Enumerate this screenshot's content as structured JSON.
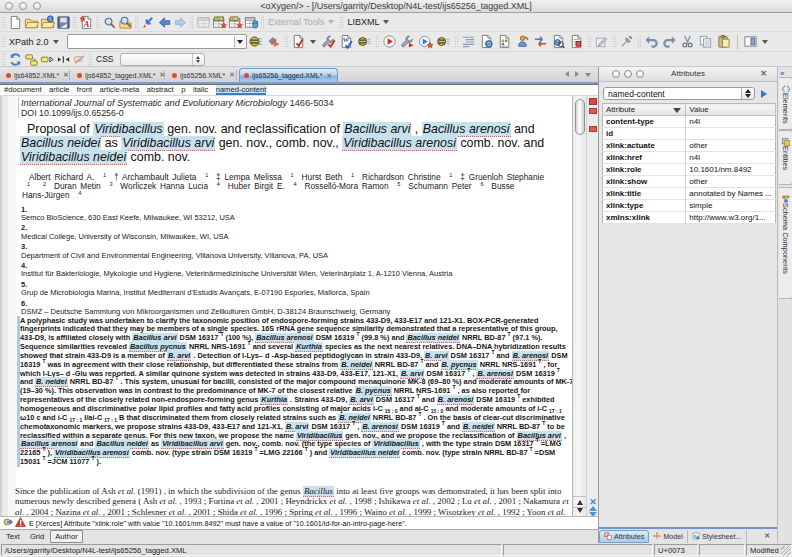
{
  "window": {
    "title": "<oXygen/> - [/Users/garrity/Desktop/N4L-test/ijs65256_tagged.XML]"
  },
  "toolbar": {
    "row1": [
      {
        "sep": 1
      },
      {
        "icon": "new-document"
      },
      {
        "icon": "open-folder"
      },
      {
        "icon": "open-url"
      },
      {
        "icon": "save"
      },
      {
        "sep": 1
      },
      {
        "icon": "new-from-template"
      },
      {
        "sep": 1
      },
      {
        "icon": "search"
      },
      {
        "icon": "search-in-files"
      },
      {
        "sep": 1
      },
      {
        "icon": "go-to-last-edit"
      },
      {
        "icon": "back"
      },
      {
        "icon": "forward"
      },
      {
        "sep": 1
      },
      {
        "icon": "grid-view"
      },
      {
        "icon": "xslt-transform"
      },
      {
        "icon": "xquery-transform"
      },
      {
        "icon": "database-table"
      },
      {
        "sep": 1
      },
      {
        "label": "External Tools",
        "caret": 1,
        "gray": 1
      },
      {
        "sep": 1
      },
      {
        "label": "LIBXML",
        "caret": 1
      }
    ],
    "row2a_label": "XPath 2.0",
    "row2": [
      {
        "icon": "watch-settings"
      },
      {
        "icon": "switch-arrows"
      },
      {
        "sep": 1
      },
      {
        "icon": "validate"
      },
      {
        "caret": 1
      },
      {
        "icon": "validate-schema"
      },
      {
        "icon": "well-formed"
      },
      {
        "icon": "key"
      },
      {
        "sep": 1
      },
      {
        "icon": "apply-transformation"
      },
      {
        "icon": "configure-transformation"
      },
      {
        "icon": "debug-transformation"
      },
      {
        "icon": "key"
      },
      {
        "sep": 1
      },
      {
        "icon": "format-indent"
      },
      {
        "icon": "doc-globe"
      },
      {
        "icon": "doc-colors"
      },
      {
        "icon": "person-pin"
      },
      {
        "icon": "compare-arrows"
      },
      {
        "icon": "doc-search"
      },
      {
        "icon": "doc-red-box"
      },
      {
        "sep": 1
      },
      {
        "icon": "edit-pencil"
      },
      {
        "sep": 1
      },
      {
        "icon": "pin-brush"
      },
      {
        "sep": 1
      },
      {
        "icon": "undo"
      },
      {
        "icon": "redo"
      },
      {
        "icon": "cut"
      },
      {
        "icon": "copy"
      },
      {
        "icon": "paste"
      },
      {
        "vline": 1
      },
      {
        "icon": "panel-layout"
      },
      {
        "caret": 1
      }
    ],
    "row3": [
      {
        "sep": 1
      },
      {
        "icon": "refresh-sync"
      },
      {
        "icon": "tags"
      },
      {
        "icon": "tag-arrow"
      },
      {
        "icon": "collapse-tags"
      },
      {
        "icon": "tag-disabled"
      },
      {
        "sep": 1
      },
      {
        "label": "CSS"
      }
    ],
    "css_label": "CSS"
  },
  "tabs": [
    {
      "label": "ijs64852.XML*"
    },
    {
      "label": "ijs64852_tagged.XML*"
    },
    {
      "label": "ijs65256.XML*"
    },
    {
      "label": "ijs65256_tagged.XML*",
      "selected": true
    }
  ],
  "breadcrumb": [
    "#document",
    "article",
    "front",
    "article-meta",
    "abstract",
    "p",
    "italic",
    "named-content"
  ],
  "document": {
    "journal": "International Journal of Systematic and Evolutionary Microbiology",
    "issn": "1466-5034",
    "doi": "DOI 10.1099/ijs.0.65256-0",
    "title_lines": [
      [
        "Proposal of ",
        {
          "t": "Viridibacillus",
          "c": "hl"
        },
        " gen. nov. and reclassification of ",
        {
          "t": "Bacillus arvi",
          "c": "hl"
        },
        " , ",
        {
          "t": "Bacillus arenosi",
          "c": "hl"
        },
        " and"
      ],
      [
        {
          "t": "Bacillus neidei",
          "c": "hl"
        },
        " as ",
        {
          "t": "Viridibacillus arvi",
          "c": "hl"
        },
        " gen. nov., comb. nov., ",
        {
          "t": "Viridibacillus arenosi",
          "c": "hl"
        },
        " comb. nov. and"
      ],
      [
        {
          "t": "Viridibacillus neidei",
          "c": "hl"
        },
        " comb. nov."
      ]
    ],
    "author_lines": [
      [
        "Albert Richard A. ",
        {
          "t": "1",
          "c": "sup"
        },
        " †   Archambault Julieta ",
        {
          "t": "1",
          "c": "sup"
        },
        " ‡   Lempa Melissa ",
        {
          "t": "1",
          "c": "sup"
        },
        "   Hurst Beth ",
        {
          "t": "1",
          "c": "sup"
        },
        "   Richardson Christine ",
        {
          "t": "1",
          "c": "sup"
        },
        " ‡   Gruenloh Stephanie"
      ],
      [
        {
          "t": "1",
          "c": "sup"
        },
        " ",
        {
          "t": "2",
          "c": "sup"
        },
        "   Duran Metin ",
        {
          "t": "3",
          "c": "sup"
        },
        "   Worliczek Hanna Lucia ",
        {
          "t": "4",
          "c": "sup"
        },
        "   Huber Birgit E. ",
        {
          "t": "4",
          "c": "sup"
        },
        "   Rosselló-Mora Ramon ",
        {
          "t": "5",
          "c": "sup"
        },
        "   Schumann Peter ",
        {
          "t": "6",
          "c": "sup"
        },
        "   Busse"
      ],
      [
        "Hans-Jürgen ",
        {
          "t": "4",
          "c": "sup"
        }
      ]
    ],
    "affiliations": [
      {
        "n": "1.",
        "text": "Semco BioScience, 630 East Keefe, Milwaukee, WI 53212, USA"
      },
      {
        "n": "2.",
        "text": "Medical College, University of Wisconsin, Milwaukee, WI, USA"
      },
      {
        "n": "3.",
        "text": "Department of Civil and Environmental Engineering, Villanova University, Villanova, PA, USA"
      },
      {
        "n": "4.",
        "text": "Institut für Bakteriologie, Mykologie und Hygiene, Veterinärmedizinische Universität Wien, Veterinärplatz 1, A-1210 Vienna, Austria"
      },
      {
        "n": "5.",
        "text": "Grup de Microbiologia Marina, Institut Mediterrani d'Estudis Avançats, E-07190 Esporles, Mallorca, Spain"
      },
      {
        "n": "6.",
        "text": "DSMZ – Deutsche Sammlung von Mikroorganismen und Zellkulturen GmbH, D-38124 Braunschweig, Germany"
      }
    ],
    "abstract_lines": [
      [
        "A polyphasic study was undertaken to clarify the taxonomic position of endospore-forming strains 433-D9, 433-E17 and 121-X1. BOX-PCR-generated"
      ],
      [
        "fingerprints indicated that they may be members of a single species. 16S rRNA gene sequence similarity demonstrated that a representative of this group,"
      ],
      [
        "433-D9, is affiliated closely with ",
        {
          "t": "Bacillus arvi",
          "c": "hl"
        },
        " DSM 16317 ",
        {
          "t": "T",
          "c": "sup"
        },
        " (100 %), ",
        {
          "t": "Bacillus arenosi",
          "c": "hl"
        },
        " DSM 16319 ",
        {
          "t": "T",
          "c": "sup"
        },
        " (99.8 %) and ",
        {
          "t": "Bacillus neidei",
          "c": "hl"
        },
        " NRRL BD-87 ",
        {
          "t": "T",
          "c": "sup"
        },
        " (97.1 %)."
      ],
      [
        "Sequence similarities revealed ",
        {
          "t": "Bacillus pycnus",
          "c": "hl"
        },
        " NRRL NRS-1691 ",
        {
          "t": "T",
          "c": "sup"
        },
        " and several ",
        {
          "t": "Kurthia",
          "c": "hl"
        },
        " species as the next nearest relatives. DNA–DNA hybridization results"
      ],
      [
        "showed that strain 433-D9 is a member of ",
        {
          "t": "B. arvi",
          "c": "hl"
        },
        " . Detection of l-Lys– d -Asp-based peptidoglycan in strain 433-D9, ",
        {
          "t": "B. arvi",
          "c": "hl"
        },
        " DSM 16317 ",
        {
          "t": "T",
          "c": "sup"
        },
        " and ",
        {
          "t": "B. arenosi",
          "c": "hl"
        },
        " DSM"
      ],
      [
        "16319 ",
        {
          "t": "T",
          "c": "sup"
        },
        " was in agreement with their close relationship, but differentiated these strains from ",
        {
          "t": "B. neidei",
          "c": "hl"
        },
        " NRRL BD-87 ",
        {
          "t": "T",
          "c": "sup"
        },
        " and ",
        {
          "t": "B. pycnus",
          "c": "hl"
        },
        " NRRL NRS-1691 ",
        {
          "t": "T",
          "c": "sup"
        },
        " , for"
      ],
      [
        "which l-Lys– d -Glu was reported. A similar quinone system was detected in strains 433-D9, 433-E17, 121-X1, ",
        {
          "t": "B. arvi",
          "c": "hl"
        },
        " DSM 16317 ",
        {
          "t": "T",
          "c": "sup"
        },
        " , ",
        {
          "t": "B. arenosi",
          "c": "hl"
        },
        " DSM 16319 ",
        {
          "t": "T",
          "c": "sup"
        }
      ],
      [
        "and ",
        {
          "t": "B. neidei",
          "c": "hl"
        },
        " NRRL BD-87 ",
        {
          "t": "T",
          "c": "sup"
        },
        " . This system, unusual for bacilli, consisted of the major compound menaquinone MK-8 (69–80 %) and moderate amounts of MK-7"
      ],
      [
        "(19–30 %). This observation was in contrast to the predominance of MK-7 of the closest relative ",
        {
          "t": "B. pycnus",
          "c": "hl"
        },
        " NRRL NRS-1691 ",
        {
          "t": "T",
          "c": "sup"
        },
        " , as also reported for"
      ],
      [
        "representatives of the closely related non-endospore-forming genus ",
        {
          "t": "Kurthia",
          "c": "hl"
        },
        " . Strains 433-D9, ",
        {
          "t": "B. arvi",
          "c": "hl"
        },
        " DSM 16317 ",
        {
          "t": "T",
          "c": "sup"
        },
        " and ",
        {
          "t": "B. arenosi",
          "c": "hl"
        },
        " DSM 16319 ",
        {
          "t": "T",
          "c": "sup"
        },
        " exhibited"
      ],
      [
        "homogeneous and discriminative polar lipid profiles and fatty acid profiles consisting of major acids i-C ",
        {
          "t": "15 : 0",
          "c": "sub"
        },
        " and ai-C ",
        {
          "t": "15 : 0",
          "c": "sub"
        },
        " and moderate amounts of i-C ",
        {
          "t": "17 : 1",
          "c": "sub"
        }
      ],
      [
        "ω10 c and i-C ",
        {
          "t": "17 : 1",
          "c": "sub"
        },
        " I/ai-C ",
        {
          "t": "17 : 1",
          "c": "sub"
        },
        " B that discriminated them from closely related strains such as ",
        {
          "t": "B. neidei",
          "c": "hl"
        },
        " NRRL BD-87 ",
        {
          "t": "T",
          "c": "sup"
        },
        " . On the basis of clear-cut discriminative"
      ],
      [
        "chemotaxonomic markers, we propose strains 433-D9, 433-E17 and 121-X1, ",
        {
          "t": "B. arvi",
          "c": "hl"
        },
        " DSM 16317 ",
        {
          "t": "T",
          "c": "sup"
        },
        " , ",
        {
          "t": "B. arenosi",
          "c": "hl"
        },
        " DSM 16319 ",
        {
          "t": "T",
          "c": "sup"
        },
        " and ",
        {
          "t": "B. neidei",
          "c": "hl"
        },
        " NRRL BD-87 ",
        {
          "t": "T",
          "c": "sup"
        },
        " to be"
      ],
      [
        "reclassified within a separate genus. For this new taxon, we propose the name ",
        {
          "t": "Viridibacillus",
          "c": "hl"
        },
        " gen. nov., and we propose the reclassification of ",
        {
          "t": "Bacillus arvi",
          "c": "hl"
        },
        " ,"
      ],
      [
        {
          "t": "Bacillus arenosi",
          "c": "hl"
        },
        " and ",
        {
          "t": "Bacillus neidei",
          "c": "hl"
        },
        " as ",
        {
          "t": "Viridibacillus arvi",
          "c": "hl"
        },
        " gen. nov., comb. nov. (the type species of ",
        {
          "t": "Viridibacillus",
          "c": "hl"
        },
        " , with the type strain DSM 16317 ",
        {
          "t": "T",
          "c": "sup"
        },
        " =LMG"
      ],
      [
        "22165 ",
        {
          "t": "T",
          "c": "sup"
        },
        " ), ",
        {
          "t": "Viridibacillus arenosi",
          "c": "hl"
        },
        " comb. nov. (type strain DSM 16319 ",
        {
          "t": "T",
          "c": "sup"
        },
        " =LMG 22166 ",
        {
          "t": "T",
          "c": "sup"
        },
        " ) and ",
        {
          "t": "Viridibacillus neidei",
          "c": "hl"
        },
        " comb. nov. (type strain NRRL BD-87 ",
        {
          "t": "T",
          "c": "sup"
        },
        " =DSM"
      ],
      [
        "15031 ",
        {
          "t": "T",
          "c": "sup"
        },
        " =JCM 11077 ",
        {
          "t": "T",
          "c": "sup"
        },
        " )."
      ]
    ],
    "body_lines": [
      [
        "Since the publication of Ash ",
        {
          "t": "et al.",
          "c": "i"
        },
        " (1991) , in which the subdivision of the genus ",
        {
          "t": "Bacillus",
          "c": "hl"
        },
        " into at least five groups was demonstrated, it has been split into"
      ],
      [
        "numerous newly described genera ( Ash ",
        {
          "t": "et al.",
          "c": "i"
        },
        " , 1993 ; Fortina ",
        {
          "t": "et al.",
          "c": "i"
        },
        " , 2001 ; Heyndrickx ",
        {
          "t": "et al.",
          "c": "i"
        },
        " , 1998 ; Ishikawa ",
        {
          "t": "et al.",
          "c": "i"
        },
        " , 2002 ; Lu ",
        {
          "t": "et al.",
          "c": "i"
        },
        " , 2001 ; Nakamura ",
        {
          "t": "et",
          "c": "i"
        }
      ],
      [
        {
          "t": "al.",
          "c": "i"
        },
        " , 2004 ; Nazina ",
        {
          "t": "et al.",
          "c": "i"
        },
        " , 2001 ; Schlesner ",
        {
          "t": "et al.",
          "c": "i"
        },
        " , 2001 ; Shida ",
        {
          "t": "et al.",
          "c": "i"
        },
        " , 1996 ; Spring ",
        {
          "t": "et al.",
          "c": "i"
        },
        " , 1996 ; Waino ",
        {
          "t": "et al.",
          "c": "i"
        },
        " , 1999 ; Wisotzkey ",
        {
          "t": "et al.",
          "c": "i"
        },
        " , 1992 ; Yoon ",
        {
          "t": "et al.",
          "c": "i"
        }
      ]
    ]
  },
  "error_bar": {
    "severity": "E",
    "text": "E [Xerces] Attribute \"xlink:role\" with value \"10.1601/nm.8492\" must have a value of \"10.1601/id-for-an-intro-page-here\"."
  },
  "mode_tabs": [
    {
      "label": "Text"
    },
    {
      "label": "Grid"
    },
    {
      "label": "Author",
      "selected": true
    }
  ],
  "status_bar": {
    "path": "/Users/garrity/Desktop/N4L-test/ijs65256_tagged.XML",
    "unicode": "U+0073",
    "modified": "Modified"
  },
  "attributes_panel": {
    "title": "Attributes",
    "element_combo": "named-content",
    "columns": [
      "Attribute",
      "Value"
    ],
    "rows": [
      [
        "content-type",
        "n4l"
      ],
      [
        "id",
        ""
      ],
      [
        "xlink:actuate",
        "other"
      ],
      [
        "xlink:href",
        "n4l"
      ],
      [
        "xlink:role",
        "10.1601/nm.8492"
      ],
      [
        "xlink:show",
        "other"
      ],
      [
        "xlink:title",
        "annotated by Names ..."
      ],
      [
        "xlink:type",
        "simple"
      ],
      [
        "xmlns:xlink",
        "http://www.w3.org/1..."
      ]
    ],
    "bottom_tabs": [
      {
        "label": "Attributes",
        "icon": "attributes-tab-icon",
        "selected": true
      },
      {
        "label": "Model",
        "icon": "model-tab-icon"
      },
      {
        "label": "Stylesheet...",
        "icon": "stylesheet-tab-icon"
      }
    ],
    "side_tabs": [
      {
        "label": "Elements",
        "icon": "elements-tab-icon"
      },
      {
        "label": "Entities",
        "icon": "entities-tab-icon"
      },
      {
        "label": "Schema Components",
        "icon": "schema-components-tab-icon"
      }
    ]
  }
}
